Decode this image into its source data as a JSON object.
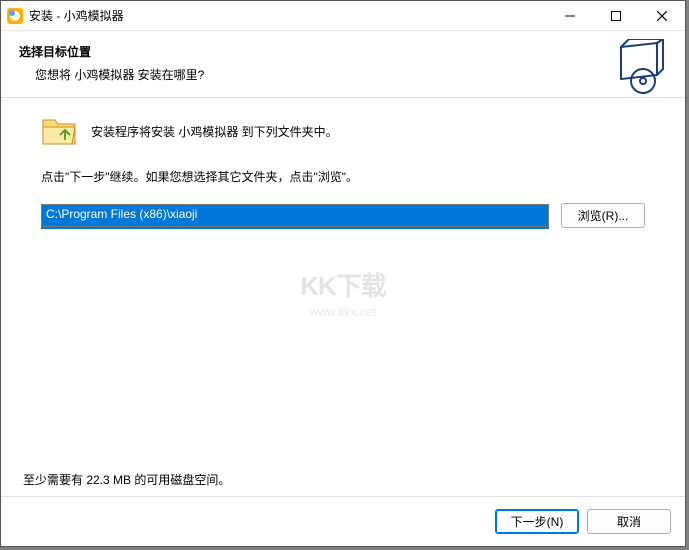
{
  "window": {
    "title": "安装 - 小鸡模拟器"
  },
  "header": {
    "title": "选择目标位置",
    "subtitle": "您想将 小鸡模拟器 安装在哪里?"
  },
  "content": {
    "folder_line": "安装程序将安装 小鸡模拟器 到下列文件夹中。",
    "instruction": "点击\"下一步\"继续。如果您想选择其它文件夹，点击\"浏览\"。",
    "path_value": "C:\\Program Files (x86)\\xiaoji",
    "browse_label": "浏览(R)...",
    "disk_space": "至少需要有 22.3 MB 的可用磁盘空间。"
  },
  "footer": {
    "next_label": "下一步(N)",
    "cancel_label": "取消"
  },
  "watermark": {
    "logo": "KK下载",
    "url": "www.kkx.net"
  }
}
